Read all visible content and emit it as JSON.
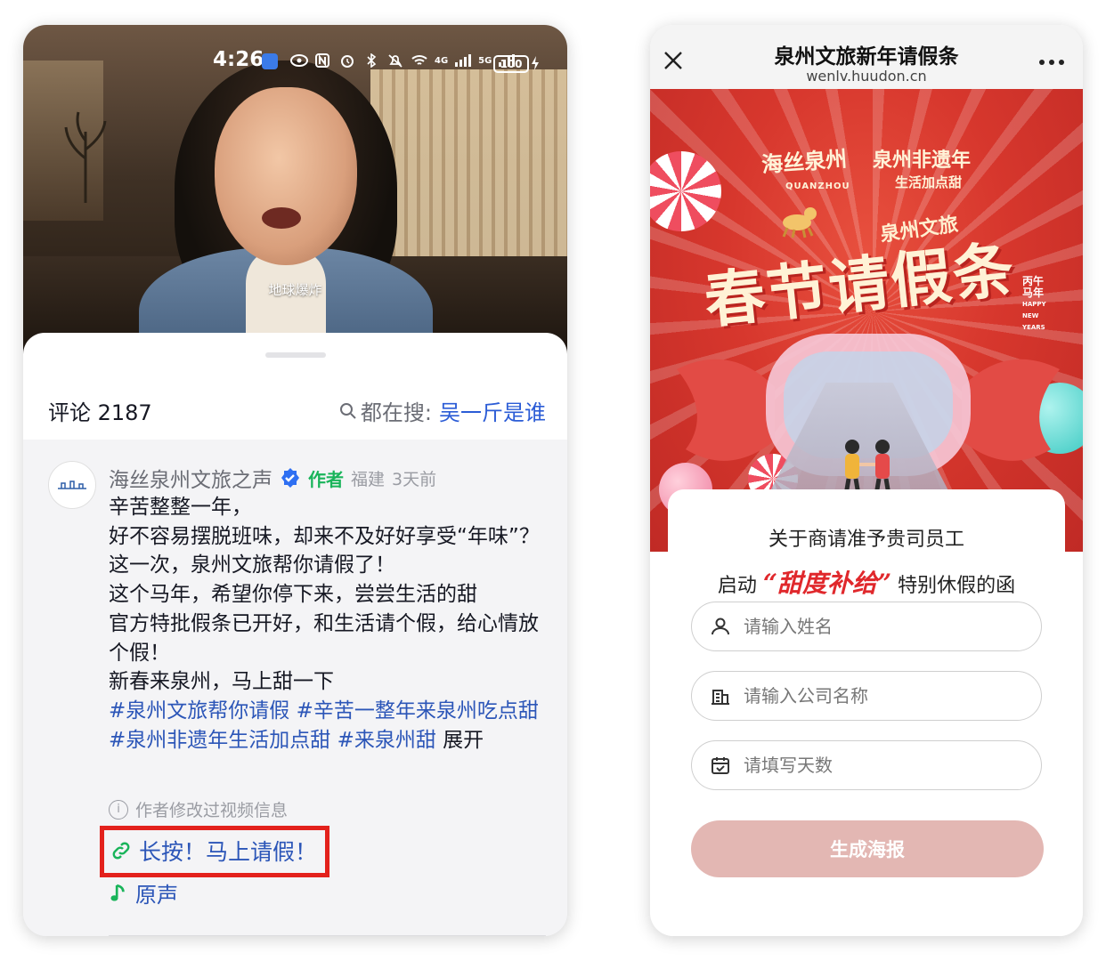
{
  "left_screen": {
    "status_bar": {
      "time": "4:26",
      "battery": "100",
      "network_labels": [
        "4G",
        "5G"
      ]
    },
    "video": {
      "subtitle": "地球爆炸"
    },
    "comments": {
      "count_label": "评论 2187",
      "search_prefix": "都在搜:",
      "search_keyword": "吴一斤是谁"
    },
    "comment": {
      "author": "海丝泉州文旅之声",
      "author_tag": "作者",
      "location": "福建",
      "time_ago": "3天前",
      "lines": [
        "辛苦整整一年，",
        "好不容易摆脱班味，却来不及好好享受“年味”？",
        "这一次，泉州文旅帮你请假了！",
        "这个马年，希望你停下来，尝尝生活的甜",
        "官方特批假条已开好，和生活请个假，给心情放个假！",
        "新春来泉州，马上甜一下"
      ],
      "hashtags": "#泉州文旅帮你请假 #辛苦一整年来泉州吃点甜 #泉州非遗年生活加点甜 #来泉州甜",
      "expand_label": "展开",
      "edited_note": "作者修改过视频信息",
      "link_text": "长按！马上请假！",
      "music_text": "原声"
    },
    "colors": {
      "link": "#2c56b8",
      "highlight_box": "#e3211c",
      "author_tag": "#19b45a"
    }
  },
  "right_screen": {
    "browser": {
      "title": "泉州文旅新年请假条",
      "url": "wenlv.huudon.cn"
    },
    "poster": {
      "logo_left": "海丝泉州",
      "logo_left_sub": "QUANZHOU",
      "logo_right": "泉州非遗年",
      "logo_right_sub": "生活加点甜",
      "headline_small": "泉州文旅",
      "headline": "春节请假条",
      "side_badge": [
        "丙午",
        "马年",
        "HAPPY",
        "NEW",
        "YEARS"
      ]
    },
    "form": {
      "title_line1": "关于商请准予贵司员工",
      "title_line2_prefix": "启动",
      "title_line2_highlight": "“甜度补给”",
      "title_line2_suffix": "特别休假的函",
      "name_placeholder": "请输入姓名",
      "company_placeholder": "请输入公司名称",
      "days_placeholder": "请填写天数",
      "submit_label": "生成海报"
    },
    "colors": {
      "poster_red": "#d7372d",
      "submit_bg": "#e3b7b3",
      "highlight_red": "#e0282c"
    },
    "icons": [
      "close-icon",
      "more-icon",
      "user-icon",
      "building-icon",
      "calendar-icon"
    ]
  }
}
